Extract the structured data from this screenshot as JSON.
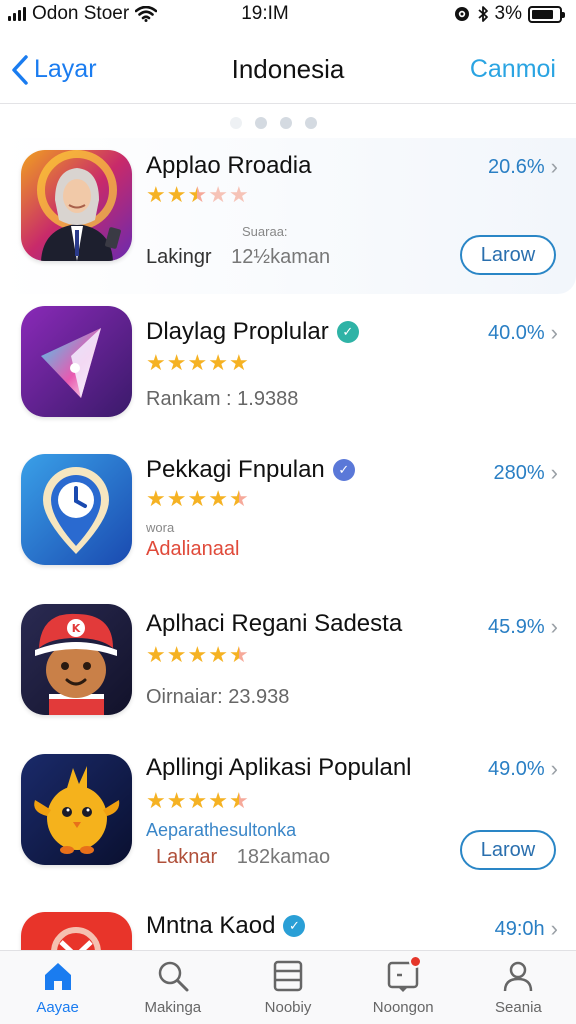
{
  "status_bar": {
    "carrier": "Odon Stoer",
    "time": "19:IM",
    "battery_text": "3%",
    "battery_level": 0.8
  },
  "nav": {
    "back_label": "Layar",
    "title": "Indonesia",
    "right_label": "Canmoi"
  },
  "apps": [
    {
      "name": "Applao Rroadia",
      "rating": 2.5,
      "percent": "20.6%",
      "meta_label": "Lakingr",
      "meta_value": "12½kaman",
      "sublabel": "Suaraa:",
      "button": "Larow",
      "verified_color": "",
      "icon": "person-with-phone-icon"
    },
    {
      "name": "Dlaylag Proplular",
      "rating": 5,
      "percent": "40.0%",
      "meta_label": "Rankam : 1.9388",
      "meta_value": "",
      "sublabel": "",
      "button": "",
      "verified_color": "#2fb3a6",
      "icon": "abstract-arrow-icon"
    },
    {
      "name": "Pekkagi Fnpulan",
      "rating": 4.5,
      "percent": "280%",
      "meta_label": "Adalianaal",
      "meta_value": "",
      "sublabel": "wora",
      "button": "",
      "verified_color": "#5a78d8",
      "icon": "clock-pin-icon"
    },
    {
      "name": "Aplhaci Regani Sadesta",
      "rating": 4.5,
      "percent": "45.9%",
      "meta_label": "Oirnaiar: 23.938",
      "meta_value": "",
      "sublabel": "",
      "button": "",
      "verified_color": "",
      "icon": "mascot-cap-icon"
    },
    {
      "name": "Apllingi Aplikasi Populanl",
      "rating": 4.5,
      "percent": "49.0%",
      "meta_label": "Laknar",
      "meta_value": "182kamao",
      "sublabel": "Aeparathesultonka",
      "button": "Larow",
      "verified_color": "",
      "icon": "yellow-bird-icon"
    },
    {
      "name": "Mntna Kaod",
      "rating": 0,
      "percent": "49:0h",
      "meta_label": "",
      "meta_value": "",
      "sublabel": "",
      "button": "",
      "verified_color": "#2a9fd6",
      "icon": "red-app-icon"
    }
  ],
  "tabs": [
    {
      "label": "Aayae",
      "icon": "home-icon",
      "active": true
    },
    {
      "label": "Makinga",
      "icon": "search-icon",
      "active": false
    },
    {
      "label": "Noobiy",
      "icon": "list-icon",
      "active": false
    },
    {
      "label": "Noongon",
      "icon": "notification-icon",
      "active": false
    },
    {
      "label": "Seania",
      "icon": "profile-icon",
      "active": false
    }
  ],
  "colors": {
    "accent": "#1a7cf0",
    "star": "#f5b223",
    "badge": "#e5362a"
  }
}
